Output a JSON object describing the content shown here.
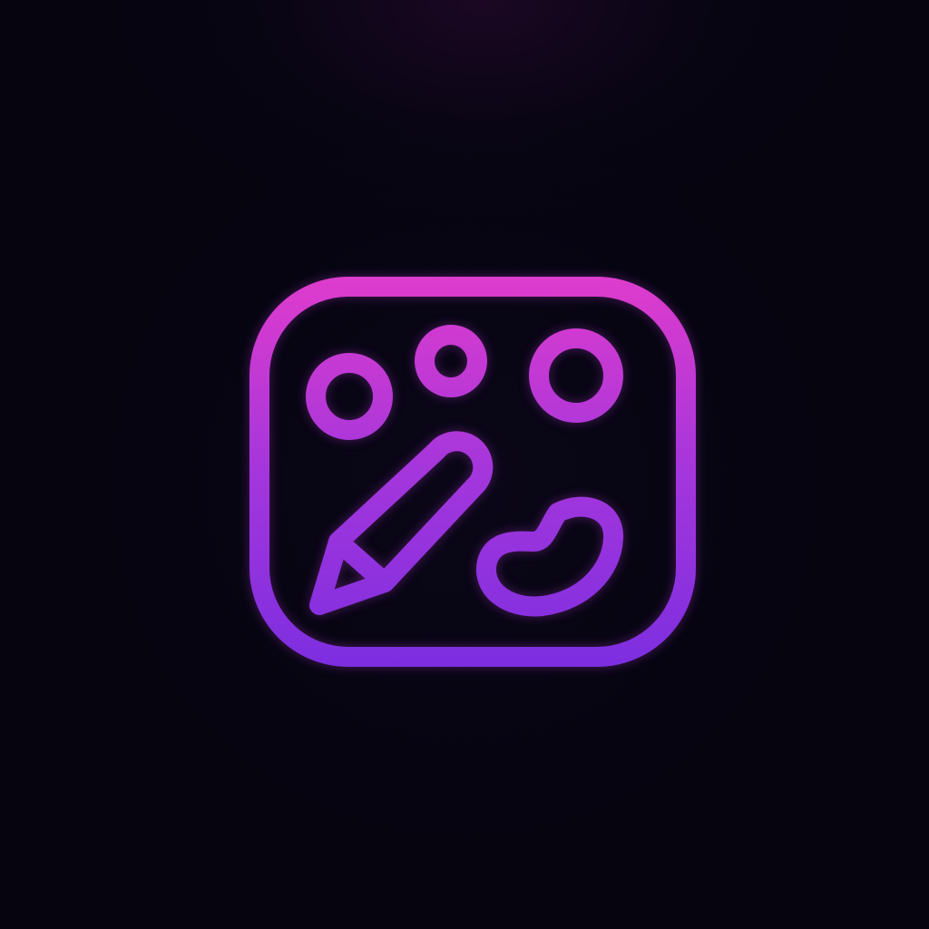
{
  "icon": {
    "name": "art-palette-icon",
    "elements": [
      "rounded-frame",
      "paint-dot-left",
      "paint-dot-middle",
      "paint-dot-right",
      "pencil",
      "paint-blob"
    ]
  },
  "colors": {
    "background": "#05040f",
    "accent_top": "#e03ccc",
    "accent_bottom": "#7c2ee0"
  }
}
